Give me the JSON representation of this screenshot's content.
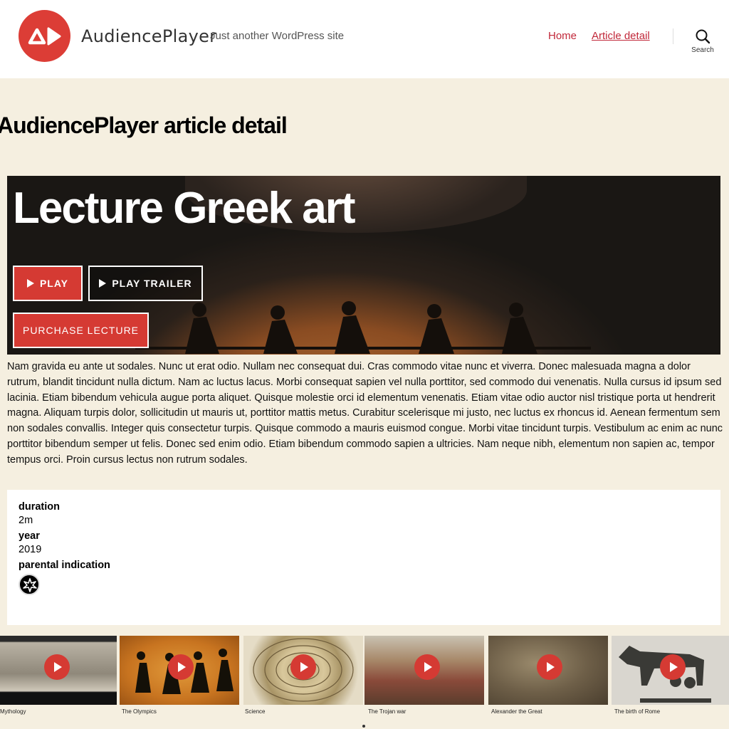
{
  "header": {
    "site_name": "AudiencePlayer",
    "tagline": "Just another WordPress site",
    "nav": [
      {
        "label": "Home"
      },
      {
        "label": "Article detail"
      }
    ],
    "search_label": "Search",
    "brand_color": "#dc3d36",
    "link_color": "#c1283a"
  },
  "page": {
    "title": "AudiencePlayer article detail",
    "background": "#f5efe0"
  },
  "hero": {
    "title": "Lecture Greek art",
    "play_label": "PLAY",
    "trailer_label": "PLAY TRAILER",
    "purchase_label": "PURCHASE LECTURE"
  },
  "description": "Nam gravida eu ante ut sodales. Nunc ut erat odio. Nullam nec consequat dui. Cras commodo vitae nunc et viverra. Donec malesuada magna a dolor rutrum, blandit tincidunt nulla dictum. Nam ac luctus lacus. Morbi consequat sapien vel nulla porttitor, sed commodo dui venenatis. Nulla cursus id ipsum sed lacinia. Etiam bibendum vehicula augue porta aliquet. Quisque molestie orci id elementum venenatis. Etiam vitae odio auctor nisl tristique porta ut hendrerit magna. Aliquam turpis dolor, sollicitudin ut mauris ut, porttitor mattis metus. Curabitur scelerisque mi justo, nec luctus ex rhoncus id. Aenean fermentum sem non sodales convallis. Integer quis consectetur turpis. Quisque commodo a mauris euismod congue. Morbi vitae tincidunt turpis. Vestibulum ac enim ac nunc porttitor bibendum semper ut felis. Donec sed enim odio. Etiam bibendum commodo sapien a ultricies. Nam neque nibh, elementum non sapien ac, tempor tempus orci. Proin cursus lectus non rutrum sodales.",
  "info": {
    "duration_label": "duration",
    "duration_value": "2m",
    "year_label": "year",
    "year_value": "2019",
    "parental_label": "parental indication",
    "parental_icon": "violence-icon"
  },
  "carousel": {
    "items": [
      {
        "caption": "Mythology"
      },
      {
        "caption": "The Olympics"
      },
      {
        "caption": "Science"
      },
      {
        "caption": "The Trojan war"
      },
      {
        "caption": "Alexander the Great"
      },
      {
        "caption": "The birth of Rome"
      }
    ]
  }
}
